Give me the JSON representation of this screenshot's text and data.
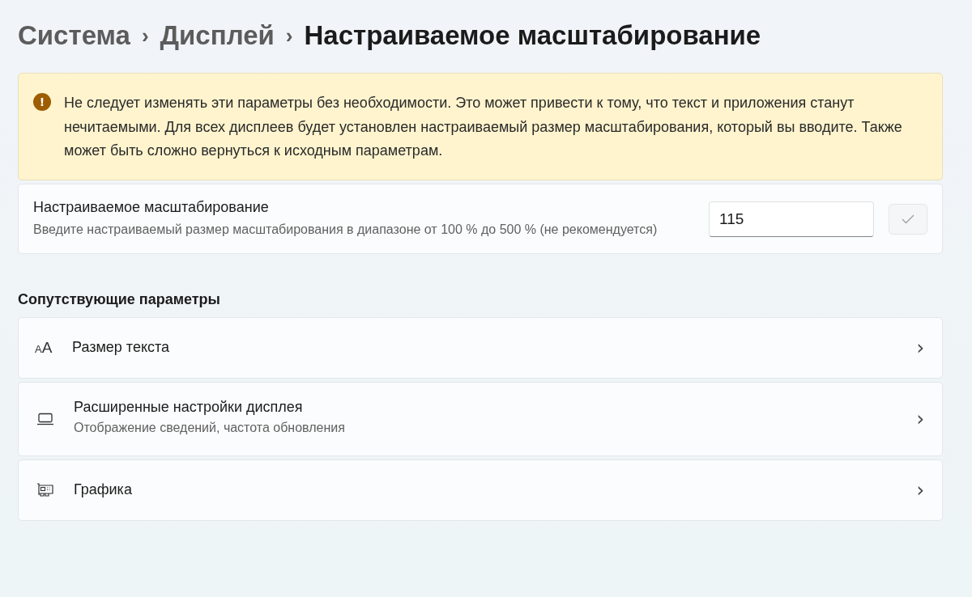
{
  "breadcrumb": [
    {
      "label": "Система",
      "current": false
    },
    {
      "label": "Дисплей",
      "current": false
    },
    {
      "label": "Настраиваемое масштабирование",
      "current": true
    }
  ],
  "breadcrumb_separator": "›",
  "warning": {
    "icon_text": "!",
    "text": "Не следует изменять эти параметры без необходимости. Это может привести к тому, что текст и приложения станут нечитаемыми. Для всех дисплеев будет установлен настраиваемый размер масштабирования, который вы вводите. Также может быть сложно вернуться к исходным параметрам."
  },
  "custom_scaling": {
    "title": "Настраиваемое масштабирование",
    "description": "Введите настраиваемый размер масштабирования в диапазоне от 100 % до 500 % (не рекомендуется)",
    "value": "115",
    "apply_disabled": true
  },
  "related": {
    "heading": "Сопутствующие параметры",
    "items": [
      {
        "kind": "text-size",
        "icon_text": "AA",
        "title": "Размер текста",
        "chevron": "›"
      },
      {
        "kind": "laptop",
        "title": "Расширенные настройки дисплея",
        "subtitle": "Отображение сведений, частота обновления",
        "chevron": "›"
      },
      {
        "kind": "graphics",
        "title": "Графика",
        "chevron": "›"
      }
    ]
  }
}
